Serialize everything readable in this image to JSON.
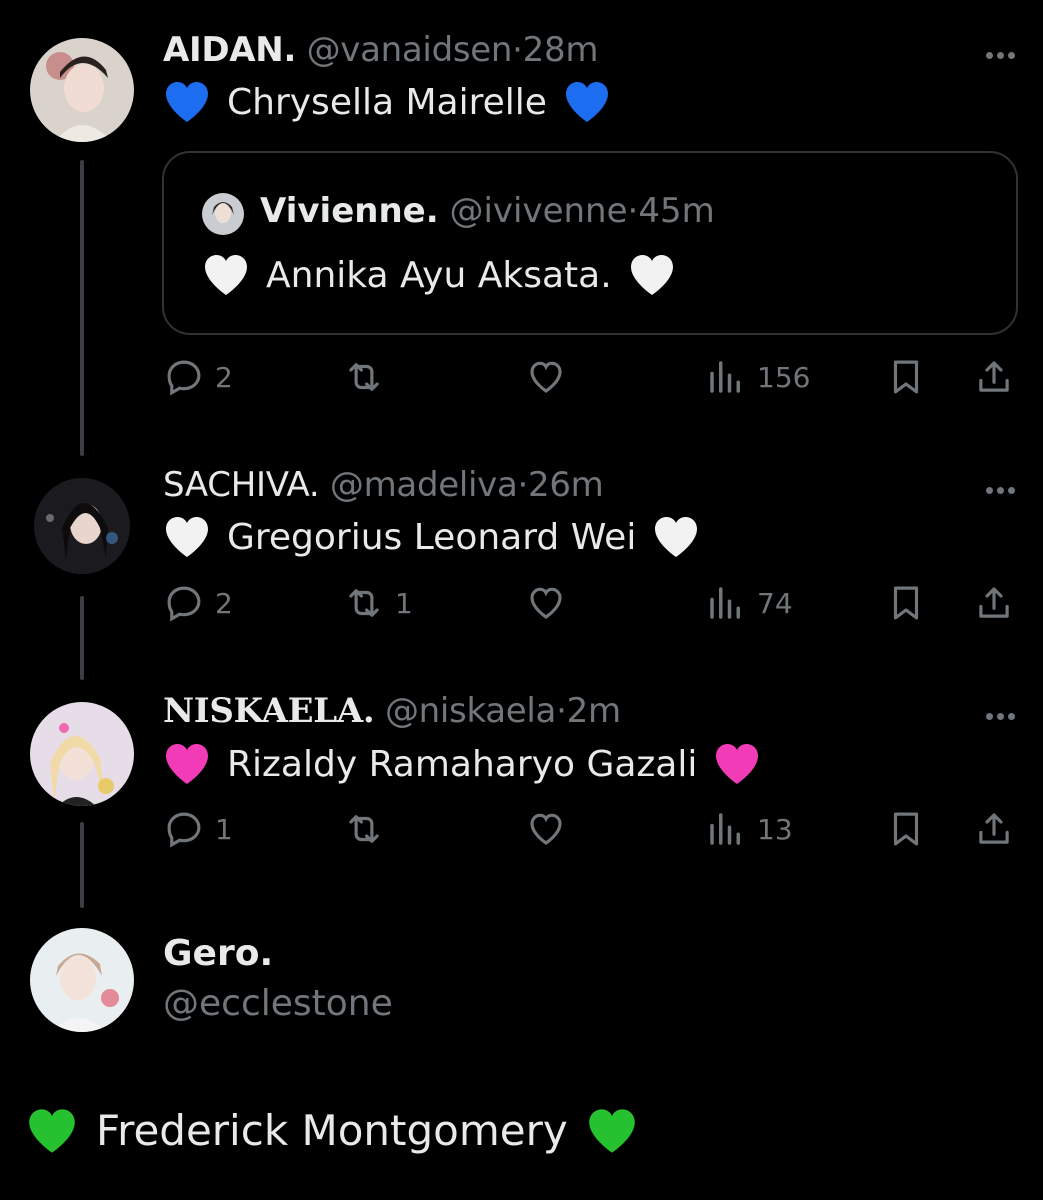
{
  "colors": {
    "blue_heart": "#1d6df0",
    "white_heart": "#f2f2f2",
    "pink_heart": "#f23bb6",
    "green_heart": "#26c12f",
    "muted": "#71767b"
  },
  "tweets": [
    {
      "display_name": "AIDAN.",
      "handle": "@vanaidsen",
      "time": "28m",
      "heart_icon": "blue-heart",
      "text": "Chrysella Mairelle",
      "quote": {
        "display_name": "Vivienne.",
        "handle": "@ivivenne",
        "time": "45m",
        "heart_icon": "white-heart",
        "text": "Annika Ayu Aksata."
      },
      "replies": "2",
      "reposts": "",
      "views": "156"
    },
    {
      "display_name": "SACHIVA.",
      "handle": "@madeliva",
      "time": "26m",
      "heart_icon": "white-heart",
      "text": "Gregorius Leonard Wei",
      "replies": "2",
      "reposts": "1",
      "views": "74"
    },
    {
      "display_name": "NISKAELA.",
      "handle": "@niskaela",
      "time": "2m",
      "heart_icon": "pink-heart",
      "text": "Rizaldy Ramaharyo Gazali",
      "replies": "1",
      "reposts": "",
      "views": "13"
    }
  ],
  "main": {
    "display_name": "Gero.",
    "handle": "@ecclestone",
    "heart_icon": "green-heart",
    "text": "Frederick Montgomery"
  },
  "separator": "·"
}
